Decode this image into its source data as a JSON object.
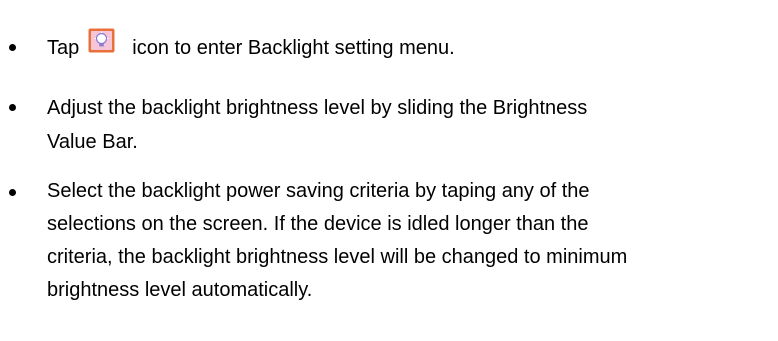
{
  "bullets": [
    {
      "before_icon": "Tap",
      "icon": "backlight-icon",
      "after_icon": "icon to enter Backlight setting menu."
    },
    {
      "lines": [
        "Adjust the backlight brightness level by sliding the Brightness",
        "Value Bar."
      ]
    },
    {
      "lines": [
        "Select the backlight power saving criteria by taping any of the",
        "selections on the screen. If the device is idled longer than the",
        "criteria, the backlight brightness level will be changed to minimum",
        "brightness level automatically."
      ]
    }
  ],
  "colors": {
    "icon_frame": "#e8703a",
    "icon_fill": "#f6c6d6",
    "icon_bulb": "#8a7bd8"
  }
}
